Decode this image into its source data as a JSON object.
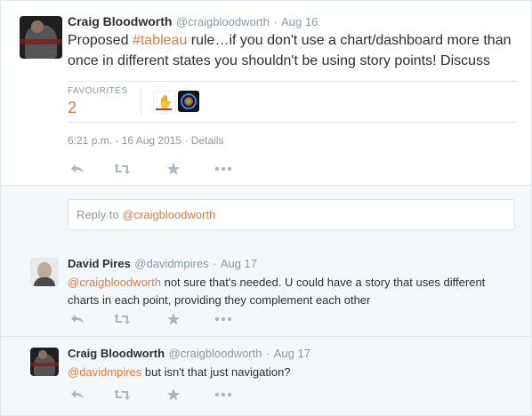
{
  "main_tweet": {
    "name": "Craig Bloodworth",
    "handle": "@craigbloodworth",
    "dot": "·",
    "date": "Aug 16",
    "text_before": "Proposed ",
    "hashtag": "#tableau",
    "text_after": " rule…if you don't use a chart/dashboard more than once in different states you shouldn't be using story points! Discuss",
    "favourites_label": "FAVOURITES",
    "favourites_count": "2",
    "timestamp": "6:21 p.m. - 16 Aug 2015",
    "timestamp_dot": "·",
    "details_link": "Details"
  },
  "reply_box": {
    "prefix": "Reply to ",
    "mention": "@craigbloodworth"
  },
  "replies": [
    {
      "name": "David Pires",
      "handle": "@davidmpires",
      "dot": "·",
      "date": "Aug 17",
      "mention": "@craigbloodworth",
      "text": " not sure that's needed. U could have a story that uses different charts in each point, providing they complement each other"
    },
    {
      "name": "Craig Bloodworth",
      "handle": "@craigbloodworth",
      "dot": "·",
      "date": "Aug 17",
      "mention": "@davidmpires",
      "text": " but isn't that just navigation?"
    }
  ],
  "icons": {
    "reply": "reply-icon",
    "retweet": "retweet-icon",
    "favorite": "star-icon",
    "more": "more-icon"
  },
  "colors": {
    "link": "#e07c3f",
    "muted": "#8899a6",
    "icon": "#aab8c2"
  }
}
